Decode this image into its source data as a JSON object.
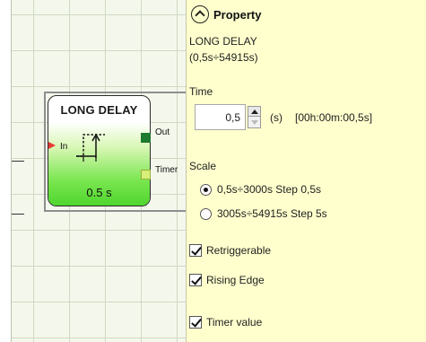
{
  "block": {
    "title": "LONG DELAY",
    "value": "0.5 s",
    "input_label": "In",
    "output_label": "Out",
    "timer_label": "Timer"
  },
  "panel": {
    "header": "Property",
    "block_name": "LONG DELAY",
    "block_range": "(0,5s÷54915s)",
    "time_label": "Time",
    "time_value": "0,5",
    "time_unit": "(s)",
    "time_readout": "[00h:00m:00,5s]",
    "scale_label": "Scale",
    "scale_options": [
      {
        "label": "0,5s÷3000s Step 0,5s",
        "selected": true
      },
      {
        "label": "3005s÷54915s Step 5s",
        "selected": false
      }
    ],
    "checkboxes": [
      {
        "label": "Retriggerable",
        "checked": true
      },
      {
        "label": "Rising Edge",
        "checked": true
      },
      {
        "label": "Timer value",
        "checked": true
      }
    ]
  },
  "colors": {
    "panel_background": "#ffffcd",
    "canvas_background": "#f4f8ec",
    "block_gradient_end": "#4fd62e",
    "input_pin": "#e53935",
    "output_pin": "#1e7a2e",
    "timer_pin": "#d6f07a"
  },
  "icons": {
    "collapse": "chevron-up-circle-icon",
    "block_symbol": "timing-diagram-icon"
  }
}
